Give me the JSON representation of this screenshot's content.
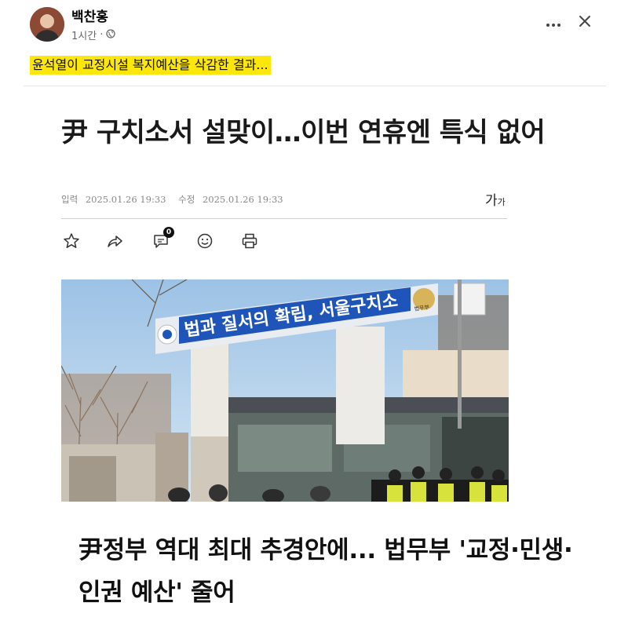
{
  "post": {
    "author": "백찬홍",
    "time": "1시간",
    "dot": "·",
    "caption": "윤석열이 교정시설 복지예산을 삭감한 결과..."
  },
  "icons": {
    "privacy": "globe-icon",
    "more": "more-icon",
    "close": "close-icon"
  },
  "article": {
    "headline": "尹 구치소서 설맞이…이번 연휴엔 특식 없어",
    "input_label": "입력",
    "input_date": "2025.01.26 19:33",
    "modified_label": "수정",
    "modified_date": "2025.01.26 19:33",
    "font_size_big": "가",
    "font_size_small": "가",
    "comment_count": "0",
    "tools": [
      "bookmark-star-icon",
      "share-icon",
      "comment-icon",
      "emoji-icon",
      "print-icon"
    ],
    "photo_sign": "법과 질서의 확립, 서울구치소",
    "photo_emblem_label": "법무부",
    "subhead": "尹정부 역대 최대 추경안에... 법무부 '교정·민생·인권 예산' 줄어"
  },
  "colors": {
    "caption_highlight": "#fde60a",
    "sign_blue": "#1f55b8",
    "meta_gray": "#65676b"
  }
}
